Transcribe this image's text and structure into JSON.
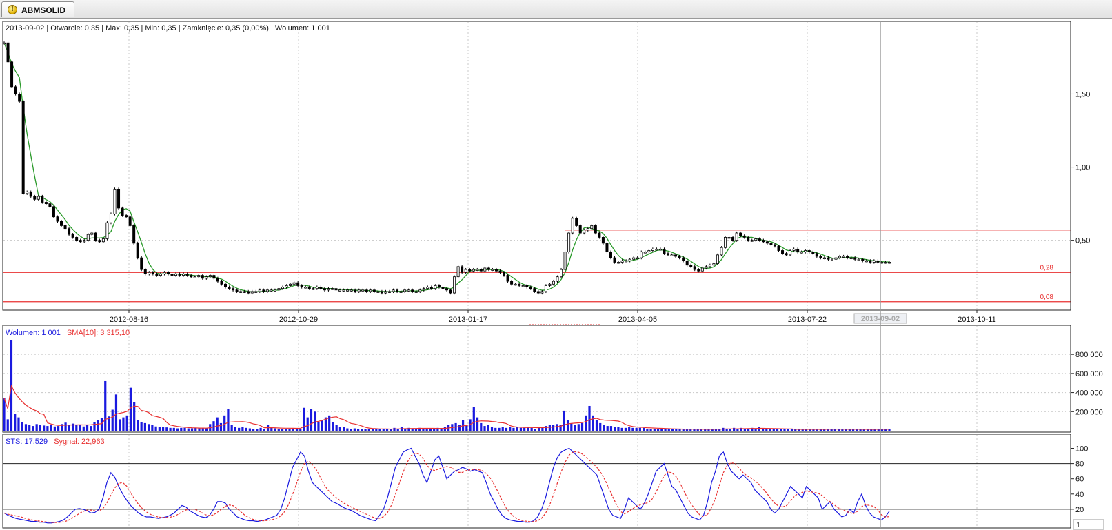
{
  "tab": {
    "label": "ABMSOLID",
    "icon": "warning-icon"
  },
  "colors": {
    "price_ma": "#2a9a2a",
    "level_line": "#e83030",
    "volume_bar": "#1a1adf",
    "volume_sma": "#e83030",
    "sts": "#1a1adf",
    "signal": "#e83030",
    "candle": "#000000"
  },
  "chart_data": [
    {
      "type": "candlestick",
      "info_line": "2013-09-02 | Otwarcie: 0,35 | Max: 0,35 | Min: 0,35 | Zamknięcie: 0,35 (0,00%)   | Wolumen: 1 001",
      "y_ticks": [
        "1,50",
        "1,00",
        "0,50"
      ],
      "y_tick_values": [
        1.5,
        1.0,
        0.5
      ],
      "ylim": [
        0.06,
        1.95
      ],
      "x_tick_labels": [
        "2012-08-16",
        "2012-10-29",
        "2013-01-17",
        "2013-04-05",
        "2013-07-22",
        "2013-09-02",
        "2013-10-11"
      ],
      "cursor_date": "2013-09-02",
      "horizontal_levels": [
        {
          "label": "0,28",
          "value": 0.28
        },
        {
          "label": "0,08",
          "value": 0.08
        },
        {
          "label": "",
          "value": 0.57
        }
      ],
      "close_series": [
        1.85,
        1.72,
        1.55,
        1.5,
        1.45,
        0.82,
        0.83,
        0.8,
        0.78,
        0.8,
        0.76,
        0.75,
        0.73,
        0.66,
        0.63,
        0.6,
        0.58,
        0.54,
        0.52,
        0.5,
        0.49,
        0.5,
        0.54,
        0.55,
        0.5,
        0.49,
        0.51,
        0.62,
        0.68,
        0.85,
        0.72,
        0.67,
        0.66,
        0.6,
        0.48,
        0.38,
        0.3,
        0.27,
        0.28,
        0.27,
        0.26,
        0.27,
        0.28,
        0.27,
        0.26,
        0.27,
        0.26,
        0.27,
        0.26,
        0.25,
        0.25,
        0.26,
        0.24,
        0.25,
        0.26,
        0.24,
        0.22,
        0.2,
        0.18,
        0.17,
        0.16,
        0.15,
        0.15,
        0.15,
        0.14,
        0.15,
        0.15,
        0.16,
        0.15,
        0.16,
        0.16,
        0.16,
        0.17,
        0.18,
        0.19,
        0.2,
        0.21,
        0.19,
        0.18,
        0.18,
        0.17,
        0.17,
        0.18,
        0.17,
        0.16,
        0.17,
        0.17,
        0.16,
        0.16,
        0.16,
        0.16,
        0.16,
        0.15,
        0.16,
        0.16,
        0.15,
        0.16,
        0.15,
        0.15,
        0.14,
        0.15,
        0.15,
        0.16,
        0.15,
        0.15,
        0.16,
        0.16,
        0.15,
        0.15,
        0.16,
        0.17,
        0.18,
        0.17,
        0.19,
        0.18,
        0.17,
        0.16,
        0.14,
        0.25,
        0.32,
        0.28,
        0.3,
        0.29,
        0.3,
        0.3,
        0.29,
        0.31,
        0.3,
        0.3,
        0.29,
        0.28,
        0.26,
        0.22,
        0.2,
        0.2,
        0.19,
        0.19,
        0.18,
        0.17,
        0.15,
        0.14,
        0.15,
        0.19,
        0.2,
        0.22,
        0.25,
        0.3,
        0.42,
        0.55,
        0.65,
        0.6,
        0.55,
        0.57,
        0.58,
        0.6,
        0.55,
        0.52,
        0.48,
        0.42,
        0.38,
        0.35,
        0.35,
        0.36,
        0.36,
        0.37,
        0.38,
        0.38,
        0.42,
        0.42,
        0.43,
        0.44,
        0.44,
        0.44,
        0.41,
        0.4,
        0.4,
        0.39,
        0.38,
        0.36,
        0.33,
        0.32,
        0.3,
        0.29,
        0.31,
        0.32,
        0.33,
        0.34,
        0.4,
        0.45,
        0.52,
        0.52,
        0.5,
        0.55,
        0.53,
        0.52,
        0.5,
        0.5,
        0.51,
        0.5,
        0.49,
        0.48,
        0.47,
        0.46,
        0.43,
        0.41,
        0.4,
        0.43,
        0.44,
        0.42,
        0.42,
        0.43,
        0.42,
        0.41,
        0.39,
        0.38,
        0.38,
        0.37,
        0.37,
        0.38,
        0.39,
        0.39,
        0.38,
        0.38,
        0.37,
        0.37,
        0.36,
        0.36,
        0.35,
        0.36,
        0.35,
        0.35,
        0.35,
        0.35
      ],
      "series": [
        {
          "ma_length": 5
        }
      ]
    },
    {
      "type": "bar",
      "legend": [
        {
          "text": "Wolumen: 1 001"
        },
        {
          "text": "SMA[10]: 3 315,10"
        }
      ],
      "y_ticks": [
        "800 000",
        "600 000",
        "400 000",
        "200 000"
      ],
      "y_tick_values": [
        800000,
        600000,
        400000,
        200000
      ],
      "ylim": [
        0,
        960000
      ],
      "values": [
        340000,
        120000,
        950000,
        180000,
        140000,
        90000,
        70000,
        60000,
        50000,
        70000,
        60000,
        55000,
        50000,
        60000,
        45000,
        50000,
        70000,
        85000,
        60000,
        75000,
        60000,
        65000,
        45000,
        60000,
        50000,
        90000,
        110000,
        130000,
        520000,
        150000,
        220000,
        380000,
        120000,
        140000,
        160000,
        450000,
        300000,
        110000,
        90000,
        80000,
        70000,
        60000,
        45000,
        40000,
        40000,
        35000,
        30000,
        30000,
        25000,
        30000,
        30000,
        25000,
        25000,
        30000,
        25000,
        30000,
        25000,
        70000,
        100000,
        140000,
        80000,
        160000,
        230000,
        60000,
        40000,
        30000,
        40000,
        30000,
        25000,
        20000,
        20000,
        30000,
        20000,
        60000,
        40000,
        25000,
        20000,
        15000,
        20000,
        15000,
        15000,
        20000,
        20000,
        240000,
        140000,
        230000,
        200000,
        90000,
        110000,
        140000,
        160000,
        90000,
        60000,
        40000,
        40000,
        25000,
        20000,
        25000,
        20000,
        20000,
        15000,
        15000,
        20000,
        15000,
        20000,
        15000,
        20000,
        15000,
        30000,
        20000,
        40000,
        20000,
        30000,
        25000,
        20000,
        30000,
        20000,
        20000,
        25000,
        20000,
        30000,
        25000,
        40000,
        60000,
        70000,
        80000,
        60000,
        110000,
        60000,
        120000,
        250000,
        140000,
        80000,
        50000,
        60000,
        40000,
        30000,
        30000,
        40000,
        30000,
        40000,
        30000,
        40000,
        30000,
        30000,
        40000,
        30000,
        20000,
        30000,
        40000,
        50000,
        60000,
        60000,
        70000,
        60000,
        210000,
        110000,
        80000,
        60000,
        70000,
        80000,
        160000,
        260000,
        160000,
        110000,
        80000,
        60000,
        50000,
        50000,
        40000,
        40000,
        30000,
        30000,
        40000,
        30000,
        30000,
        30000,
        30000,
        20000,
        20000,
        20000,
        20000,
        15000,
        20000,
        15000,
        15000,
        20000,
        15000,
        15000,
        15000,
        15000,
        20000,
        15000,
        15000,
        15000,
        20000,
        15000,
        20000,
        15000,
        30000,
        20000,
        20000,
        30000,
        20000,
        30000,
        20000,
        20000,
        30000,
        20000,
        40000,
        20000,
        15000,
        20000,
        15000,
        15000,
        15000,
        15000,
        15000,
        15000,
        15000,
        15000,
        15000,
        15000,
        20000,
        15000,
        15000,
        15000,
        15000,
        20000,
        20000,
        15000,
        15000,
        15000,
        15000,
        15000,
        15000,
        15000,
        15000,
        15000,
        15000,
        20000,
        15000,
        20000,
        15000,
        15000,
        15000
      ],
      "series": [
        {
          "sma_length": 10
        }
      ]
    },
    {
      "type": "line",
      "legend": [
        {
          "text": "STS: 17,529"
        },
        {
          "text": "Sygnał: 22,963"
        }
      ],
      "y_ticks": [
        "100",
        "80",
        "60",
        "40",
        "20"
      ],
      "y_tick_values": [
        100,
        80,
        60,
        40,
        20
      ],
      "ylim": [
        0,
        105
      ],
      "reference_lines": [
        80,
        20
      ],
      "page_indicator": "1",
      "values": [
        15,
        12,
        10,
        8,
        7,
        6,
        5,
        4,
        4,
        3,
        3,
        2,
        2,
        3,
        4,
        6,
        10,
        15,
        20,
        21,
        20,
        18,
        15,
        16,
        20,
        35,
        55,
        68,
        62,
        50,
        40,
        32,
        25,
        20,
        15,
        12,
        10,
        10,
        9,
        8,
        9,
        10,
        12,
        15,
        20,
        25,
        23,
        18,
        15,
        12,
        10,
        9,
        12,
        20,
        30,
        30,
        28,
        20,
        15,
        10,
        8,
        6,
        5,
        5,
        4,
        5,
        6,
        8,
        10,
        12,
        20,
        35,
        55,
        75,
        85,
        95,
        90,
        70,
        55,
        50,
        45,
        40,
        35,
        30,
        28,
        25,
        22,
        20,
        18,
        15,
        12,
        10,
        8,
        6,
        5,
        12,
        20,
        35,
        55,
        75,
        85,
        95,
        98,
        100,
        90,
        80,
        65,
        55,
        70,
        85,
        90,
        75,
        60,
        65,
        70,
        72,
        75,
        73,
        70,
        72,
        70,
        68,
        55,
        40,
        30,
        20,
        12,
        8,
        6,
        5,
        4,
        4,
        3,
        3,
        5,
        10,
        20,
        35,
        55,
        75,
        88,
        95,
        98,
        100,
        95,
        90,
        85,
        80,
        75,
        70,
        65,
        50,
        35,
        20,
        12,
        10,
        8,
        20,
        35,
        30,
        25,
        20,
        28,
        40,
        55,
        70,
        75,
        80,
        65,
        50,
        45,
        35,
        25,
        15,
        10,
        8,
        6,
        12,
        30,
        55,
        70,
        90,
        95,
        80,
        70,
        65,
        60,
        65,
        60,
        55,
        45,
        40,
        35,
        30,
        20,
        15,
        20,
        30,
        40,
        50,
        45,
        40,
        35,
        50,
        45,
        40,
        35,
        20,
        25,
        30,
        20,
        15,
        10,
        12,
        20,
        15,
        30,
        40,
        25,
        15,
        10,
        8,
        6,
        10,
        17.5
      ],
      "series": [
        {
          "signal_smoothing": 5
        }
      ]
    }
  ]
}
